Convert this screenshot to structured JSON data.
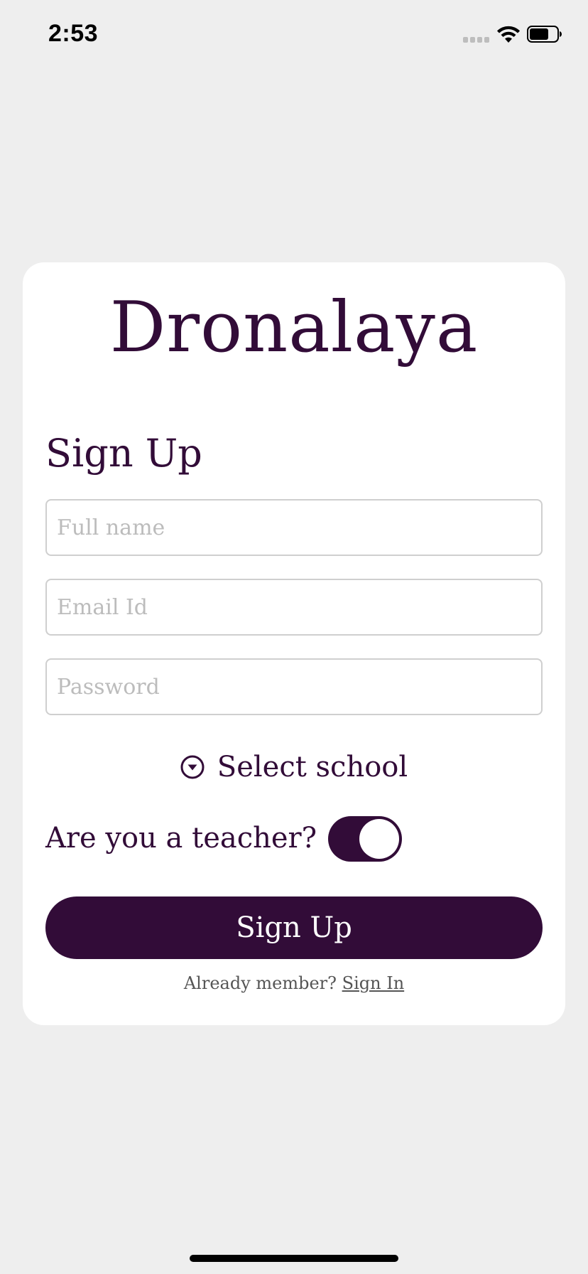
{
  "status_bar": {
    "time": "2:53",
    "icons": [
      "signal-icon",
      "wifi-icon",
      "battery-icon"
    ]
  },
  "brand": {
    "title": "Dronalaya"
  },
  "form": {
    "heading": "Sign Up",
    "full_name_placeholder": "Full name",
    "email_placeholder": "Email Id",
    "password_placeholder": "Password",
    "full_name_value": "",
    "email_value": "",
    "password_value": "",
    "school_picker_label": "Select school",
    "teacher_question": "Are you a teacher?",
    "teacher_toggle_on": true,
    "submit_label": "Sign Up",
    "signin_prompt": "Already member?",
    "signin_link": "Sign In"
  },
  "colors": {
    "primary": "#320c38",
    "background": "#eeeeee",
    "card": "#ffffff",
    "placeholder": "#bcbcbc",
    "muted_text": "#555555"
  }
}
